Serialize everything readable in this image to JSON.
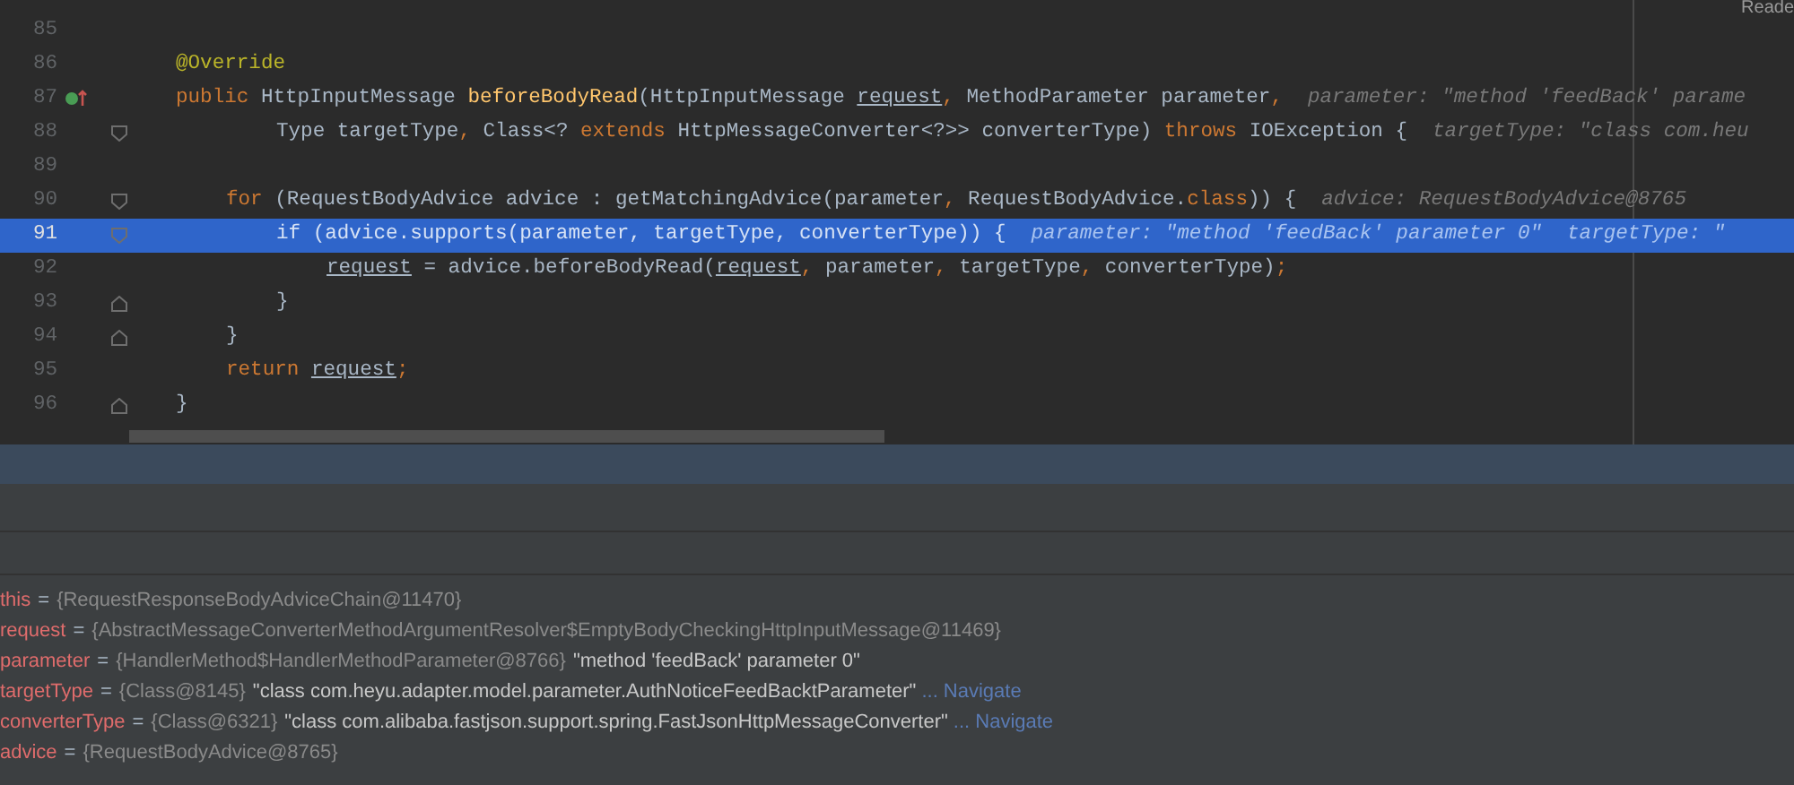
{
  "editor": {
    "reader_mode": "Reade",
    "lines": [
      {
        "number": "85",
        "selected": false
      },
      {
        "number": "86",
        "selected": false,
        "tokens": [
          {
            "kind": "annotation",
            "text": "@Override"
          }
        ]
      },
      {
        "number": "87",
        "selected": false,
        "kind": "override",
        "tokens": [
          {
            "kind": "keyword",
            "text": "public "
          },
          {
            "kind": "plain",
            "text": "HttpInputMessage "
          },
          {
            "kind": "method",
            "text": "beforeBodyRead"
          },
          {
            "kind": "plain",
            "text": "(HttpInputMessage "
          },
          {
            "kind": "param",
            "text": "request"
          },
          {
            "kind": "keyword",
            "text": ", "
          },
          {
            "kind": "plain",
            "text": "MethodParameter parameter"
          },
          {
            "kind": "keyword",
            "text": ","
          },
          {
            "kind": "hint",
            "text": "parameter: \"method 'feedBack' parame"
          }
        ],
        "children": [
          {
            "number": "88",
            "selected": false,
            "wrapped": true,
            "kind": "fold-start",
            "tokens": [
              {
                "kind": "plain",
                "text": "Type targetType"
              },
              {
                "kind": "keyword",
                "text": ", "
              },
              {
                "kind": "plain",
                "text": "Class<? "
              },
              {
                "kind": "keyword",
                "text": "extends "
              },
              {
                "kind": "plain",
                "text": "HttpMessageConverter<?>> converterType) "
              },
              {
                "kind": "keyword",
                "text": "throws "
              },
              {
                "kind": "plain",
                "text": "IOException {"
              },
              {
                "kind": "hint",
                "text": "targetType: \"class com.heu"
              }
            ]
          },
          {
            "number": "89",
            "selected": false
          },
          {
            "number": "90",
            "selected": false,
            "kind": "fold-start",
            "tokens": [
              {
                "kind": "keyword",
                "text": "for "
              },
              {
                "kind": "plain",
                "text": "(RequestBodyAdvice advice : getMatchingAdvice(parameter"
              },
              {
                "kind": "keyword",
                "text": ", "
              },
              {
                "kind": "plain",
                "text": "RequestBodyAdvice."
              },
              {
                "kind": "keyword",
                "text": "class"
              },
              {
                "kind": "plain",
                "text": ")) {"
              },
              {
                "kind": "hint",
                "text": "advice: RequestBodyAdvice@8765"
              }
            ],
            "children": [
              {
                "number": "91",
                "selected": true,
                "kind": "fold-start",
                "tokens": [
                  {
                    "kind": "keyword",
                    "text": "if "
                  },
                  {
                    "kind": "plain",
                    "text": "(advice.supports(parameter"
                  },
                  {
                    "kind": "keyword",
                    "text": ", "
                  },
                  {
                    "kind": "plain",
                    "text": "targetType"
                  },
                  {
                    "kind": "keyword",
                    "text": ", "
                  },
                  {
                    "kind": "plain",
                    "text": "converterType)) {"
                  },
                  {
                    "kind": "hint",
                    "text": "parameter: \"method 'feedBack' parameter 0\""
                  },
                  {
                    "kind": "hint",
                    "text": "targetType: \""
                  }
                ],
                "children": [
                  {
                    "number": "92",
                    "selected": false,
                    "tokens": [
                      {
                        "kind": "param",
                        "text": "request"
                      },
                      {
                        "kind": "plain",
                        "text": " = advice.beforeBodyRead("
                      },
                      {
                        "kind": "param",
                        "text": "request"
                      },
                      {
                        "kind": "keyword",
                        "text": ", "
                      },
                      {
                        "kind": "plain",
                        "text": "parameter"
                      },
                      {
                        "kind": "keyword",
                        "text": ", "
                      },
                      {
                        "kind": "plain",
                        "text": "targetType"
                      },
                      {
                        "kind": "keyword",
                        "text": ", "
                      },
                      {
                        "kind": "plain",
                        "text": "converterType)"
                      },
                      {
                        "kind": "keyword",
                        "text": ";"
                      }
                    ]
                  }
                ]
              },
              {
                "number": "93",
                "selected": false,
                "kind": "fold-end",
                "tokens": [
                  {
                    "kind": "plain",
                    "text": "}"
                  }
                ]
              }
            ]
          },
          {
            "number": "94",
            "selected": false,
            "kind": "fold-end",
            "tokens": [
              {
                "kind": "plain",
                "text": "}"
              }
            ]
          },
          {
            "number": "95",
            "selected": false,
            "tokens": [
              {
                "kind": "keyword",
                "text": "return "
              },
              {
                "kind": "param",
                "text": "request"
              },
              {
                "kind": "keyword",
                "text": ";"
              }
            ]
          }
        ]
      },
      {
        "number": "96",
        "selected": false,
        "kind": "fold-end",
        "tokens": [
          {
            "kind": "plain",
            "text": "}"
          }
        ]
      }
    ]
  },
  "variables": [
    {
      "name": "this",
      "sign": "=",
      "value": "{RequestResponseBodyAdviceChain@11470}"
    },
    {
      "name": "request",
      "sign": "=",
      "value": "{AbstractMessageConverterMethodArgumentResolver$EmptyBodyCheckingHttpInputMessage@11469}"
    },
    {
      "name": "parameter",
      "sign": "=",
      "value": "{HandlerMethod$HandlerMethodParameter@8766}",
      "string": "\"method 'feedBack' parameter 0\""
    },
    {
      "name": "targetType",
      "sign": "=",
      "value": "{Class@8145}",
      "string": "\"class com.heyu.adapter.model.parameter.AuthNoticeFeedBacktParameter\"",
      "link": "... Navigate"
    },
    {
      "name": "converterType",
      "sign": "=",
      "value": "{Class@6321}",
      "string": "\"class com.alibaba.fastjson.support.spring.FastJsonHttpMessageConverter\"",
      "link": "... Navigate"
    },
    {
      "name": "advice",
      "sign": "=",
      "value": "{RequestBodyAdvice@8765}"
    }
  ]
}
